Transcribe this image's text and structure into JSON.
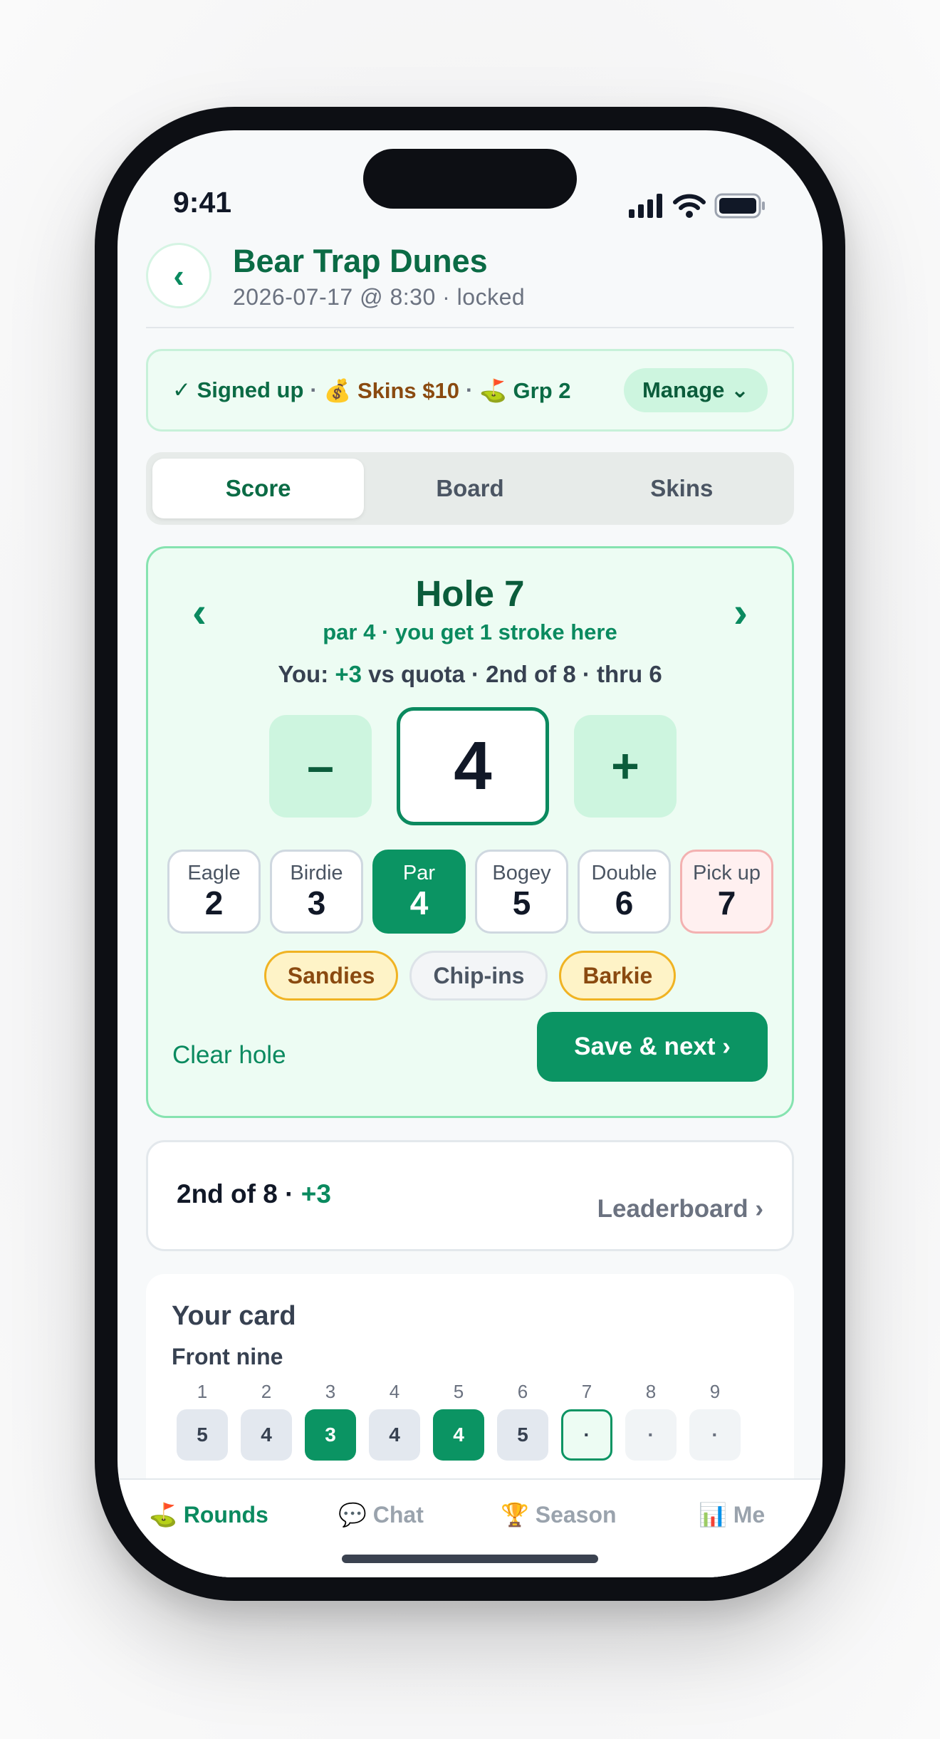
{
  "status": {
    "time": "9:41"
  },
  "header": {
    "back_icon": "chevron-left-icon",
    "title": "Bear Trap Dunes",
    "subtitle": "2026-07-17 @ 8:30 · locked"
  },
  "banner": {
    "signed_up": "✓ Signed up",
    "skins": "💰 Skins $10",
    "group": "⛳ Grp 2",
    "separator": "·",
    "manage_label": "Manage ⌄"
  },
  "tabs": [
    "Score",
    "Board",
    "Skins"
  ],
  "active_tab": "Score",
  "hole": {
    "prev": "‹",
    "next": "›",
    "title": "Hole 7",
    "subtitle": "par 4 · you get 1 stroke here",
    "quota_prefix": "You: ",
    "quota_value": "+3",
    "quota_suffix": " vs quota · 2nd of 8 · thru 6",
    "minus": "–",
    "plus": "+",
    "score": "4",
    "quick": [
      {
        "label": "Eagle",
        "value": "2"
      },
      {
        "label": "Birdie",
        "value": "3"
      },
      {
        "label": "Par",
        "value": "4"
      },
      {
        "label": "Bogey",
        "value": "5"
      },
      {
        "label": "Double",
        "value": "6"
      },
      {
        "label": "Pick up",
        "value": "7"
      }
    ],
    "selected_quick": "Par",
    "chips": [
      "Sandies",
      "Chip-ins",
      "Barkie"
    ],
    "clear_label": "Clear hole",
    "save_label": "Save & next ›"
  },
  "standing": {
    "place": "2nd of 8 · ",
    "score": "+3",
    "leaderboard_label": "Leaderboard ›"
  },
  "your_card": {
    "title": "Your card",
    "section": "Front nine",
    "holes": [
      "1",
      "2",
      "3",
      "4",
      "5",
      "6",
      "7",
      "8",
      "9"
    ],
    "scores": [
      "5",
      "4",
      "3",
      "4",
      "4",
      "5",
      "·",
      "·",
      "·"
    ],
    "current_hole": "7"
  },
  "tabbar": [
    {
      "label": "⛳ Rounds"
    },
    {
      "label": "💬 Chat"
    },
    {
      "label": "🏆 Season"
    },
    {
      "label": "📊 Me"
    }
  ],
  "colors": {
    "accent": "#0b9463",
    "dark_green": "#0b5c3b",
    "gold": "#f0b323"
  }
}
